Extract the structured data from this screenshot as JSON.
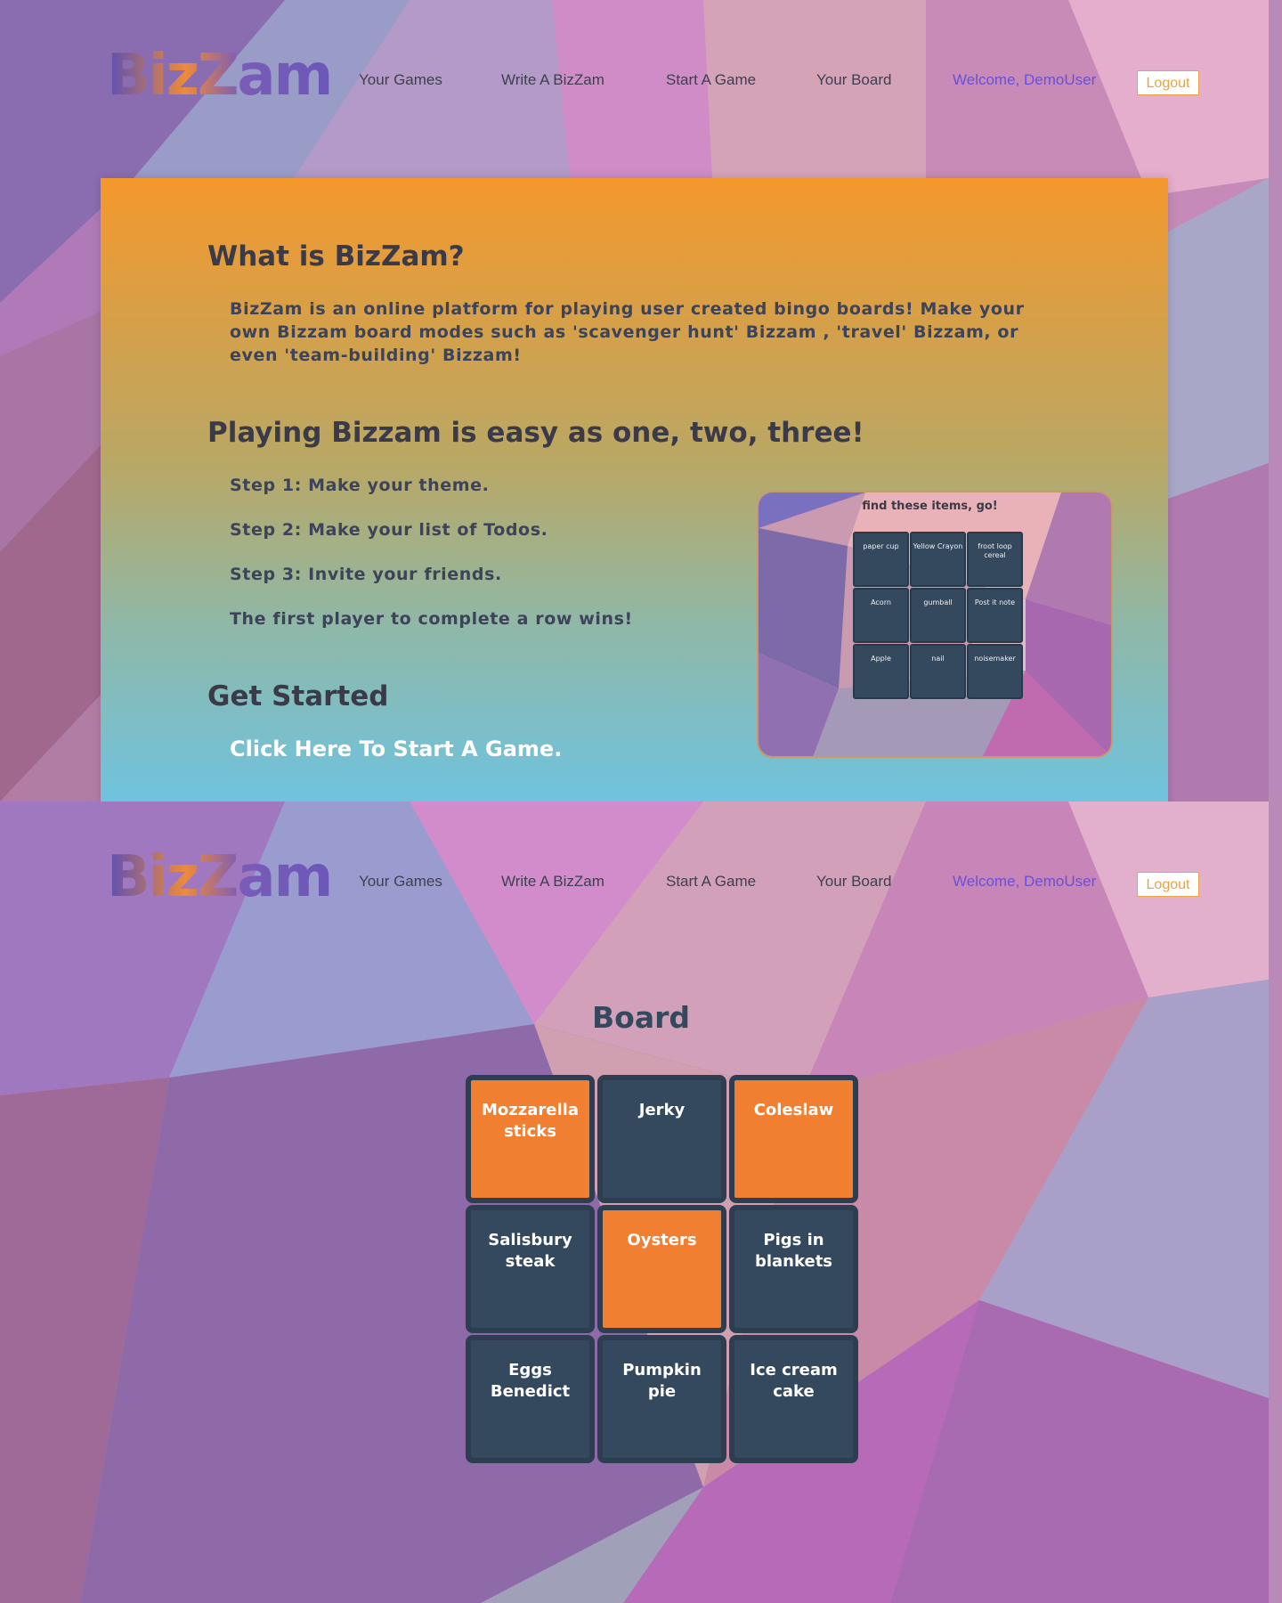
{
  "nav": {
    "logo": "BizZam",
    "links": [
      "Your Games",
      "Write A BizZam",
      "Start A Game",
      "Your Board"
    ],
    "welcome": "Welcome, DemoUser",
    "logout": "Logout"
  },
  "home": {
    "what_title": "What is BizZam?",
    "what_body": "BizZam is an online platform for playing user created bingo boards! Make your own Bizzam board modes such as 'scavenger hunt' Bizzam , 'travel' Bizzam, or even 'team-building' Bizzam!",
    "play_title": "Playing Bizzam is easy as one, two, three!",
    "steps": [
      "Step 1: Make your theme.",
      "Step 2: Make your list of Todos.",
      "Step 3: Invite your friends.",
      "The first player to complete a row wins!"
    ],
    "started_title": "Get Started",
    "cta": "Click Here To Start A Game.",
    "preview": {
      "title": "find these items, go!",
      "cells": [
        "paper cup",
        "Yellow Crayon",
        "froot loop cereal",
        "Acorn",
        "gumball",
        "Post it note",
        "Apple",
        "nail",
        "noisemaker"
      ]
    }
  },
  "board": {
    "title": "Board",
    "cells": [
      {
        "label": "Mozzarella sticks",
        "marked": true
      },
      {
        "label": "Jerky",
        "marked": false
      },
      {
        "label": "Coleslaw",
        "marked": true
      },
      {
        "label": "Salisbury steak",
        "marked": false
      },
      {
        "label": "Oysters",
        "marked": true
      },
      {
        "label": "Pigs in blankets",
        "marked": false
      },
      {
        "label": "Eggs Benedict",
        "marked": false
      },
      {
        "label": "Pumpkin pie",
        "marked": false
      },
      {
        "label": "Ice cream cake",
        "marked": false
      }
    ]
  },
  "colors": {
    "accent_orange": "#f07f32",
    "cell_dark": "#34495e",
    "welcome_purple": "#6a4fd8",
    "logout_orange": "#e8a344"
  }
}
